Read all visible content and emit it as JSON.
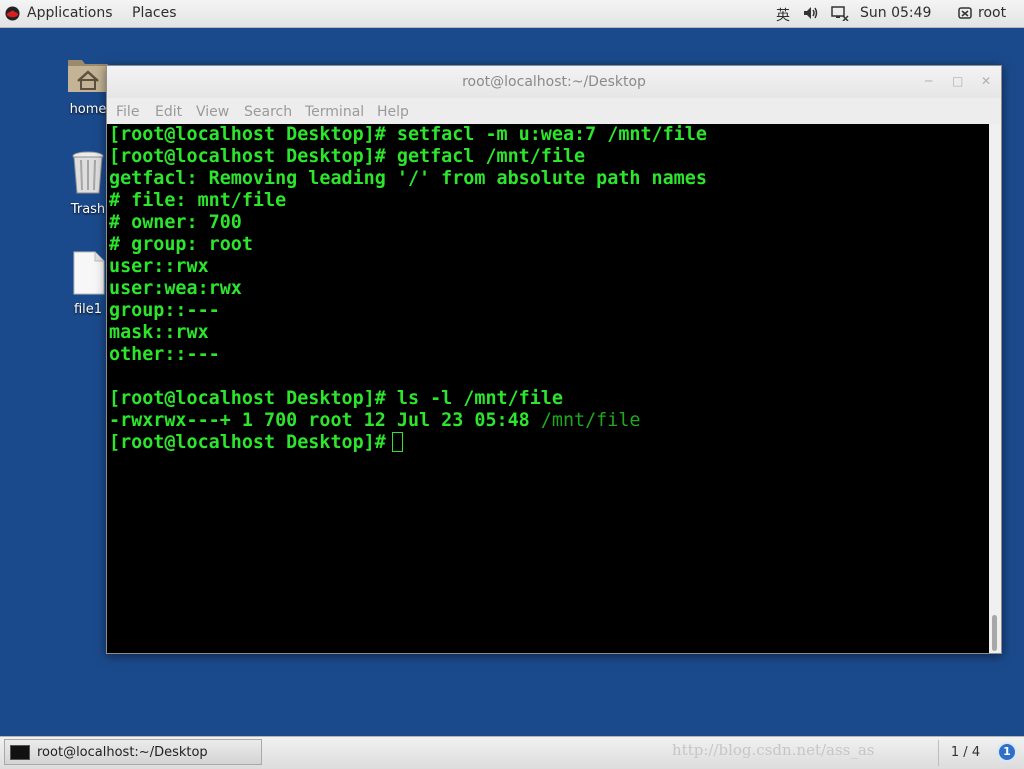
{
  "top_panel": {
    "applications": "Applications",
    "places": "Places",
    "input_method": "英",
    "clock": "Sun 05:49",
    "user": "root"
  },
  "desktop_icons": [
    {
      "label": "home",
      "icon": "home-folder-icon"
    },
    {
      "label": "Trash",
      "icon": "trash-icon"
    },
    {
      "label": "file1",
      "icon": "file-icon"
    }
  ],
  "window": {
    "title": "root@localhost:~/Desktop",
    "menu": [
      "File",
      "Edit",
      "View",
      "Search",
      "Terminal",
      "Help"
    ]
  },
  "terminal": {
    "lines": [
      "[root@localhost Desktop]# setfacl -m u:wea:7 /mnt/file",
      "[root@localhost Desktop]# getfacl /mnt/file",
      "getfacl: Removing leading '/' from absolute path names",
      "# file: mnt/file",
      "# owner: 700",
      "# group: root",
      "user::rwx",
      "user:wea:rwx",
      "group::---",
      "mask::rwx",
      "other::---",
      "",
      "[root@localhost Desktop]# ls -l /mnt/file"
    ],
    "ls_line_prefix": "-rwxrwx---+ 1 700 root 12 Jul 23 05:48 ",
    "ls_line_path": "/mnt/file",
    "prompt": "[root@localhost Desktop]#"
  },
  "bottom_panel": {
    "task_label": "root@localhost:~/Desktop",
    "watermark": "http://blog.csdn.net/ass_as",
    "workspace": "1 / 4",
    "notification_count": "1"
  },
  "colors": {
    "desktop": "#1b4a8c",
    "terminal_bg": "#000000",
    "terminal_fg": "#2ce52c"
  }
}
